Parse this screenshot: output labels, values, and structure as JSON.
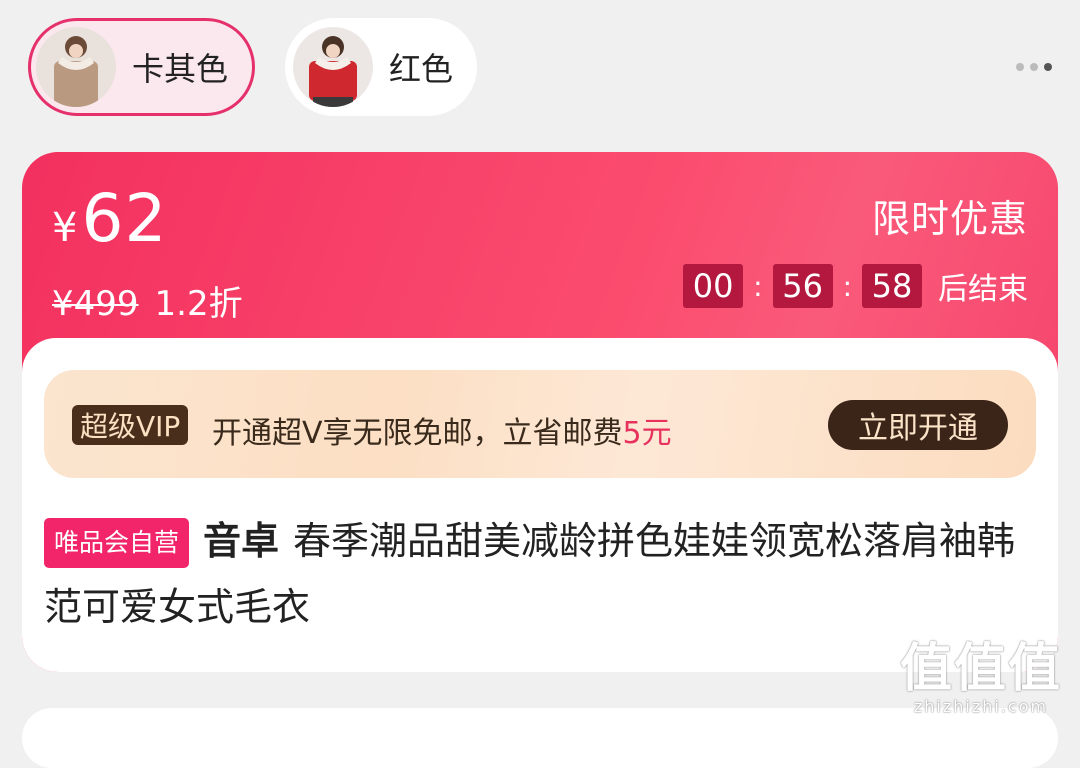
{
  "variants": [
    {
      "label": "卡其色",
      "selected": true,
      "thumb_color": "#b99a80"
    },
    {
      "label": "红色",
      "selected": false,
      "thumb_color": "#d0282f"
    }
  ],
  "price": {
    "currency": "¥",
    "current": "62",
    "original": "¥499",
    "discount": "1.2折"
  },
  "promo": {
    "title": "限时优惠",
    "countdown": {
      "hours": "00",
      "minutes": "56",
      "seconds": "58"
    },
    "separator": ":",
    "suffix": "后结束"
  },
  "vip": {
    "badge": "超级VIP",
    "text": "开通超V享无限免邮，立省邮费",
    "highlight": "5元",
    "button": "立即开通"
  },
  "product": {
    "tag": "唯品会自营",
    "brand": "音卓",
    "title": "春季潮品甜美减龄拼色娃娃领宽松落肩袖韩范可爱女式毛衣"
  },
  "watermark": {
    "logo": "值值值",
    "url": "zhizhizhi.com"
  },
  "colors": {
    "accent": "#f3305f",
    "tag": "#f2246a",
    "vip_dark": "#3b2418"
  }
}
